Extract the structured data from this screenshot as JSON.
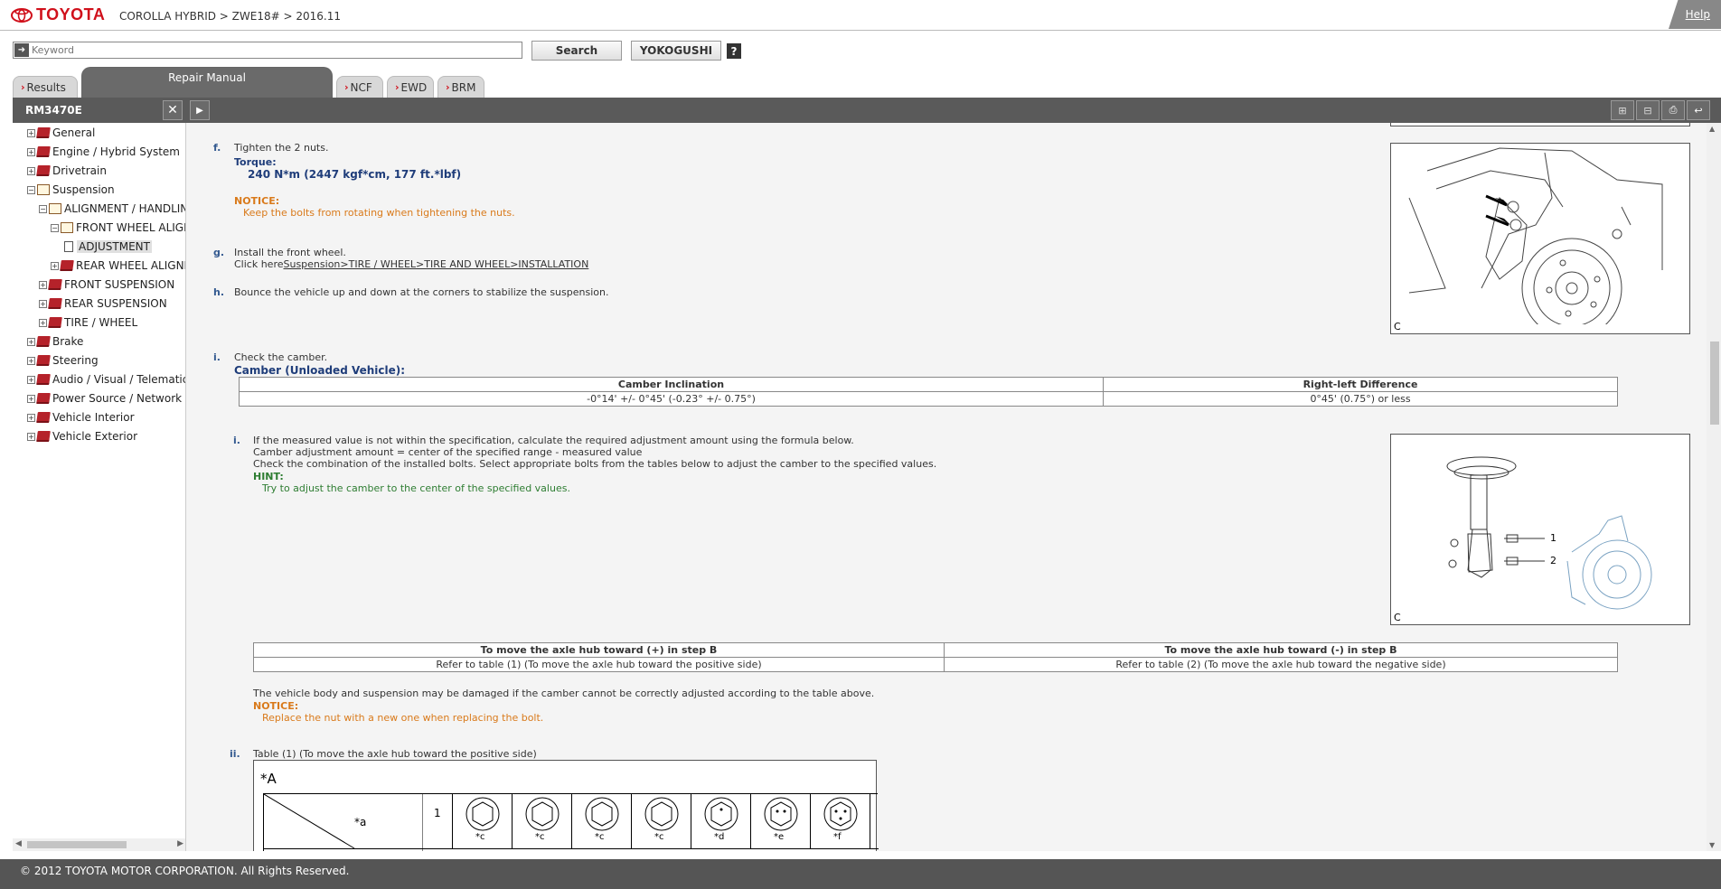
{
  "header": {
    "logo_text": "TOYOTA",
    "breadcrumb": "COROLLA HYBRID > ZWE18# > 2016.11",
    "help": "Help"
  },
  "search": {
    "placeholder": "Keyword",
    "search_label": "Search",
    "yokogushi_label": "YOKOGUSHI",
    "help_q": "?"
  },
  "tabs": [
    {
      "label": "Results"
    },
    {
      "label": "Repair Manual"
    },
    {
      "label": "NCF"
    },
    {
      "label": "EWD"
    },
    {
      "label": "BRM"
    }
  ],
  "toolbar": {
    "doc_id": "RM3470E"
  },
  "tree": [
    {
      "label": "General"
    },
    {
      "label": "Engine / Hybrid System"
    },
    {
      "label": "Drivetrain"
    },
    {
      "label": "Suspension"
    },
    {
      "label": "ALIGNMENT / HANDLING"
    },
    {
      "label": "FRONT WHEEL ALIGNMENT"
    },
    {
      "label": "ADJUSTMENT"
    },
    {
      "label": "REAR WHEEL ALIGNMENT"
    },
    {
      "label": "FRONT SUSPENSION"
    },
    {
      "label": "REAR SUSPENSION"
    },
    {
      "label": "TIRE / WHEEL"
    },
    {
      "label": "Brake"
    },
    {
      "label": "Steering"
    },
    {
      "label": "Audio / Visual / Telematics"
    },
    {
      "label": "Power Source / Network"
    },
    {
      "label": "Vehicle Interior"
    },
    {
      "label": "Vehicle Exterior"
    }
  ],
  "content": {
    "f": {
      "letter": "f.",
      "text": "Tighten the 2 nuts.",
      "torque_label": "Torque:",
      "torque_value": "240 N*m (2447 kgf*cm, 177 ft.*lbf)",
      "notice_label": "NOTICE:",
      "notice_text": "Keep the bolts from rotating when tightening the nuts."
    },
    "g": {
      "letter": "g.",
      "text": "Install the front wheel.",
      "click_prefix": "Click here",
      "link": "Suspension>TIRE / WHEEL>TIRE AND WHEEL>INSTALLATION"
    },
    "h": {
      "letter": "h.",
      "text": "Bounce the vehicle up and down at the corners to stabilize the suspension."
    },
    "i": {
      "letter": "i.",
      "text": "Check the camber.",
      "camber_title": "Camber (Unloaded Vehicle):",
      "table": {
        "headers": [
          "Camber Inclination",
          "Right-left Difference"
        ],
        "row": [
          "-0°14' +/- 0°45' (-0.23° +/- 0.75°)",
          "0°45' (0.75°) or less"
        ]
      }
    },
    "i1": {
      "letter": "i.",
      "line1": "If the measured value is not within the specification, calculate the required adjustment amount using the formula below.",
      "line2": "Camber adjustment amount = center of the specified range - measured value",
      "line3": "Check the combination of the installed bolts. Select appropriate bolts from the tables below to adjust the camber to the specified values.",
      "hint_label": "HINT:",
      "hint_text": "Try to adjust the camber to the center of the specified values."
    },
    "axle_table": {
      "headers": [
        "To move the axle hub toward (+) in step B",
        "To move the axle hub toward (-) in step B"
      ],
      "row": [
        "Refer to table (1) (To move the axle hub toward the positive side)",
        "Refer to table (2) (To move the axle hub toward the negative side)"
      ]
    },
    "damage_text": "The vehicle body and suspension may be damaged if the camber cannot be correctly adjusted according to the table above.",
    "notice2_label": "NOTICE:",
    "notice2_text": "Replace the nut with a new one when replacing the bolt.",
    "ii": {
      "letter": "ii.",
      "text": "Table (1) (To move the axle hub toward the positive side)",
      "fig_label": "*A",
      "cell_a": "*a",
      "row_num": "1",
      "bolt_labels": [
        "*c",
        "*c",
        "*c",
        "*c",
        "*d",
        "*e",
        "*f"
      ]
    },
    "fig1_caption": "C",
    "fig2_caption": "C",
    "fig2_callouts": [
      "1",
      "2"
    ]
  },
  "footer": {
    "copyright": "© 2012 TOYOTA MOTOR CORPORATION. All Rights Reserved."
  }
}
